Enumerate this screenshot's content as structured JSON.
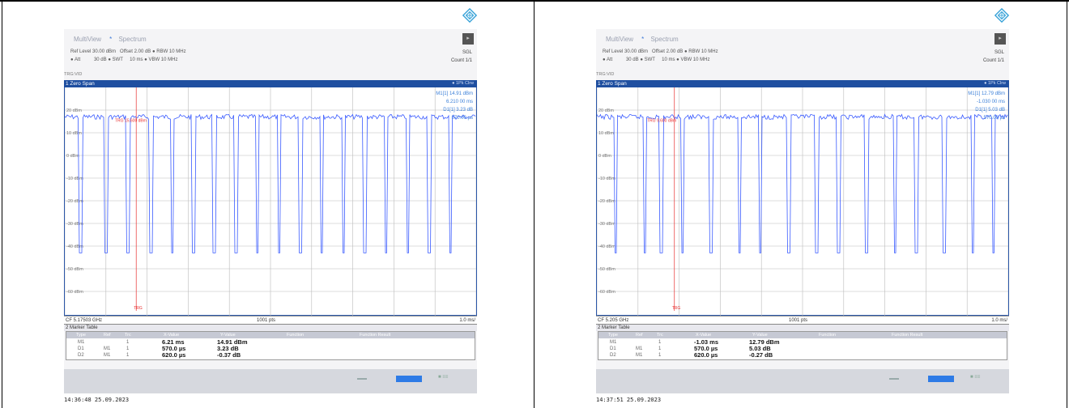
{
  "panels": [
    {
      "tabs": [
        "MultiView",
        "Spectrum"
      ],
      "header": {
        "line1": "Ref Level 30.00 dBm   Offset 2.00 dB ● RBW 10 MHz",
        "line2": "● Att          30 dB ● SWT     10 ms ● VBW 10 MHz",
        "sgl": "SGL",
        "count": "Count 1/1",
        "trg": "TRG:VID"
      },
      "window_title": "1 Zero Span",
      "window_tag": "● 1Pk Clrw",
      "marker_info": [
        "M1[1]    14.91 dBm",
        "6.210 00 ms",
        "D1[1]    3.23 dB",
        "570.00 µs"
      ],
      "trg_line_label": "TRG  15.600 dBm",
      "trg_bottom_label": "TRG",
      "y_labels": [
        "20 dBm",
        "10 dBm",
        "0 dBm",
        "-10 dBm",
        "-20 dBm",
        "-30 dBm",
        "-40 dBm",
        "-50 dBm",
        "-60 dBm"
      ],
      "status": {
        "cf": "CF 5.17503 GHz",
        "pts": "1001 pts",
        "div": "1.0 ms/"
      },
      "marker_table_title": "2 Marker Table",
      "table_headers": [
        "Type",
        "Ref",
        "Trc",
        "X-Value",
        "Y-Value",
        "Function",
        "Function Result"
      ],
      "table_rows": [
        [
          "M1",
          "",
          "1",
          "6.21 ms",
          "14.91 dBm"
        ],
        [
          "D1",
          "M1",
          "1",
          "570.0 µs",
          "3.23 dB"
        ],
        [
          "D2",
          "M1",
          "1",
          "620.0 µs",
          "-0.37 dB"
        ]
      ],
      "timestamp": "14:36:48  25.09.2023",
      "dips": [
        0.7,
        1.83,
        2.78,
        3.8,
        4.74,
        5.68,
        6.6,
        7.56,
        8.5,
        9.46,
        10.4,
        11.34,
        12.3,
        13.24,
        14.18,
        15.12,
        16.08,
        17.0
      ],
      "marker_x": 3.15,
      "colors": {
        "trace": "#3a5bff",
        "marker_line": "#e83030",
        "header_bar": "#1f4fa0"
      }
    },
    {
      "tabs": [
        "MultiView",
        "Spectrum"
      ],
      "header": {
        "line1": "Ref Level 30.00 dBm   Offset 2.00 dB ● RBW 10 MHz",
        "line2": "● Att          30 dB ● SWT     10 ms ● VBW 10 MHz",
        "sgl": "SGL",
        "count": "Count 1/1",
        "trg": "TRG:VID"
      },
      "window_title": "1 Zero Span",
      "window_tag": "● 1Pk Clrw",
      "marker_info": [
        "M1[1]    12.79 dBm",
        "-1.030 00 ms",
        "D1[1]    5.03 dB",
        "570.00 µs"
      ],
      "trg_line_label": "TRG  9.600 dBm",
      "trg_bottom_label": "TRG",
      "y_labels": [
        "20 dBm",
        "10 dBm",
        "0 dBm",
        "-10 dBm",
        "-20 dBm",
        "-30 dBm",
        "-40 dBm",
        "-50 dBm",
        "-60 dBm"
      ],
      "status": {
        "cf": "CF 5.205 GHz",
        "pts": "1001 pts",
        "div": "1.0 ms/"
      },
      "marker_table_title": "2 Marker Table",
      "table_headers": [
        "Type",
        "Ref",
        "Trc",
        "X-Value",
        "Y-Value",
        "Function",
        "Function Result"
      ],
      "table_rows": [
        [
          "M1",
          "",
          "1",
          "-1.03 ms",
          "12.79 dBm"
        ],
        [
          "D1",
          "M1",
          "1",
          "570.0 µs",
          "5.03 dB"
        ],
        [
          "D2",
          "M1",
          "1",
          "620.0 µs",
          "-0.27 dB"
        ]
      ],
      "timestamp": "14:37:51  25.09.2023",
      "dips": [
        0.82,
        2.1,
        2.84,
        3.78,
        5.04,
        6.28,
        7.22,
        8.46,
        9.7,
        10.66,
        11.9,
        13.14,
        14.08,
        15.32,
        16.58,
        17.5
      ],
      "marker_x": 3.42,
      "colors": {
        "trace": "#3a5bff",
        "marker_line": "#e83030",
        "header_bar": "#1f4fa0"
      }
    }
  ]
}
